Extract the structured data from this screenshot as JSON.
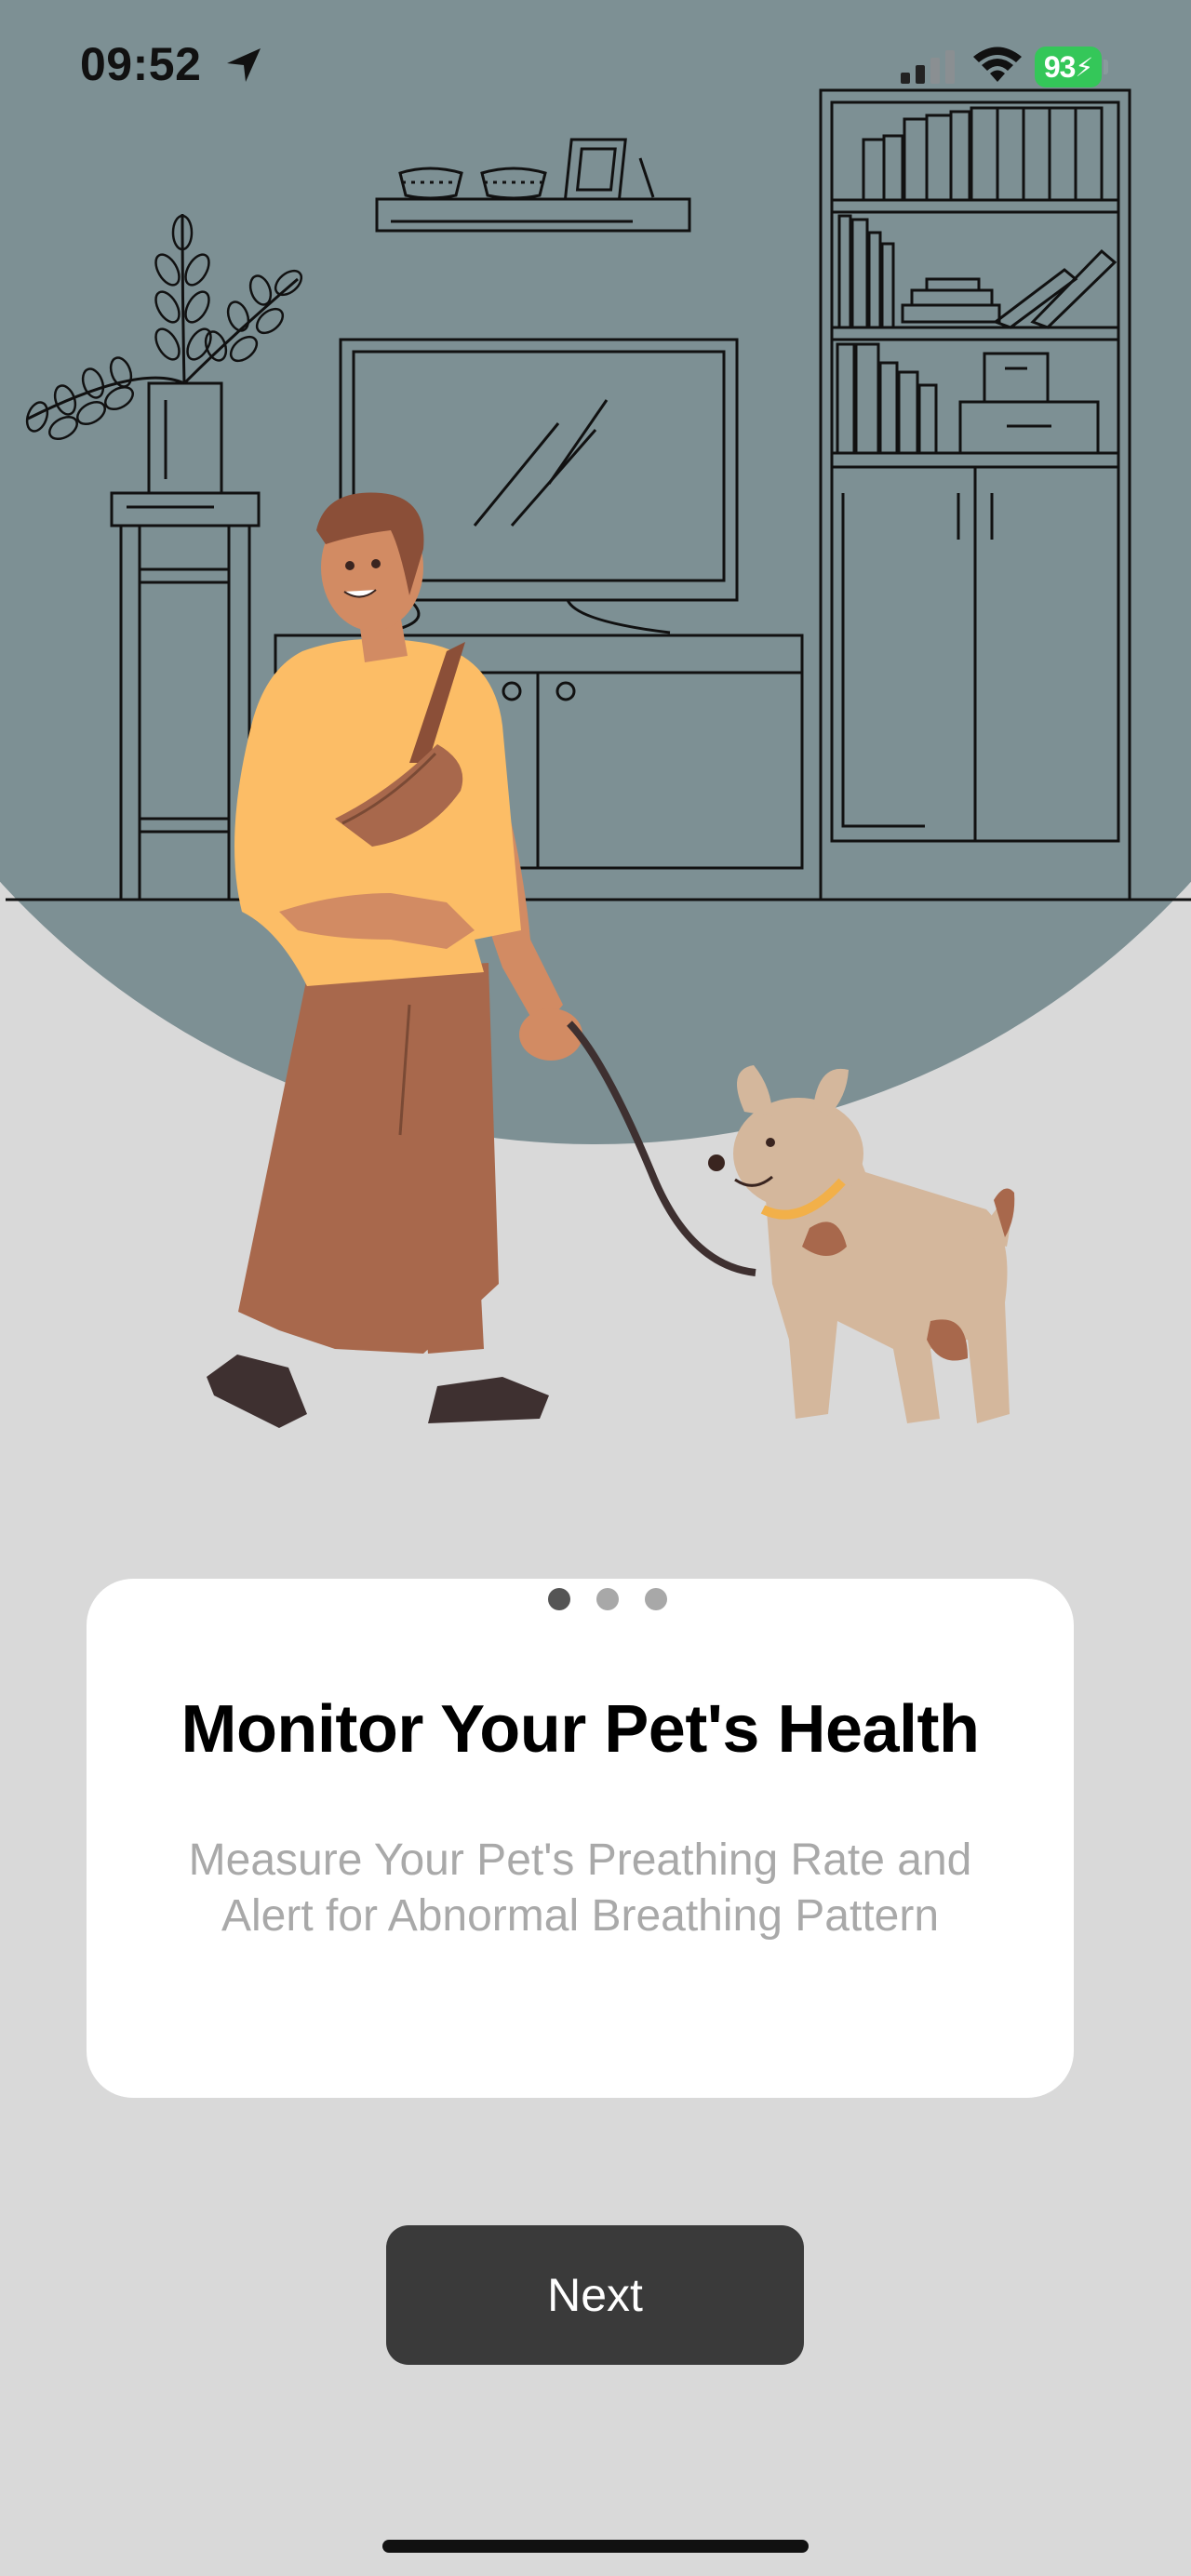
{
  "status_bar": {
    "time": "09:52",
    "battery_level": "93",
    "icons": [
      "location-arrow-icon",
      "cellular-signal-icon",
      "wifi-icon",
      "battery-charging-icon"
    ]
  },
  "illustration": {
    "name": "person-walking-dog-illustration"
  },
  "pager": {
    "total": 3,
    "active_index": 0
  },
  "onboarding": {
    "title": "Monitor Your Pet's Health",
    "subtitle_line1": "Measure Your Pet's Preathing Rate and",
    "subtitle_line2": "Alert for Abnormal Breathing Pattern"
  },
  "actions": {
    "next_label": "Next"
  },
  "colors": {
    "background": "#d9d9d9",
    "arc": "#7d9094",
    "card": "#ffffff",
    "button": "#3a3a3a",
    "battery": "#34c759",
    "subtitle": "#a9a9a9"
  }
}
